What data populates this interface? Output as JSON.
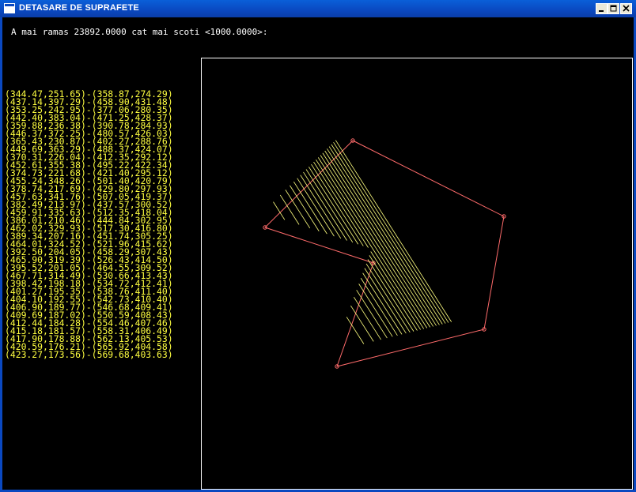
{
  "window": {
    "title": "DETASARE DE SUPRAFETE",
    "minimize_glyph": "_",
    "maximize_glyph": "□",
    "close_glyph": "×",
    "titlebar_color": "#0a48c0"
  },
  "console": {
    "prompt": "A mai ramas 23892.0000 cat mai scoti <1000.0000>:",
    "text_color": "#ffffff",
    "list_color": "#ffff40",
    "segments": [
      "(344.47,251.65)-(358.87,274.29)",
      "(437.14,397.29)-(458.90,431.48)",
      "(353.25,242.95)-(377.06,280.35)",
      "(442.40,383.04)-(471.25,428.37)",
      "(359.88,236.38)-(390.78,284.93)",
      "(446.37,372.25)-(480.57,426.03)",
      "(365.43,230.87)-(402.27,288.76)",
      "(449.69,363.29)-(488.37,424.07)",
      "(370.31,226.04)-(412.35,292.12)",
      "(452.61,355.38)-(495.22,422.34)",
      "(374.73,221.68)-(421.40,295.12)",
      "(455.24,348.26)-(501.40,420.79)",
      "(378.74,217.69)-(429.80,297.93)",
      "(457.63,341.76)-(507.05,419.37)",
      "(382.49,213.97)-(437.57,300.52)",
      "(459.91,335.63)-(512.35,418.04)",
      "(386.01,210.46)-(444.84,302.95)",
      "(462.02,329.93)-(517.30,416.80)",
      "(389.34,207.16)-(451.74,305.25)",
      "(464.01,324.52)-(521.96,415.62)",
      "(392.50,204.05)-(458.29,307.43)",
      "(465.90,319.39)-(526.43,414.50)",
      "(395.52,201.05)-(464.55,309.52)",
      "(467.71,314.49)-(530.66,413.43)",
      "(398.42,198.18)-(534.72,412.41)",
      "(401.27,195.35)-(538.76,411.40)",
      "(404.10,192.55)-(542.73,410.40)",
      "(406.90,189.77)-(546.68,409.41)",
      "(409.69,187.02)-(550.59,408.43)",
      "(412.44,184.28)-(554.46,407.46)",
      "(415.18,181.57)-(558.31,406.49)",
      "(417.90,178.88)-(562.13,405.53)",
      "(420.59,176.21)-(565.92,404.58)",
      "(423.27,173.56)-(569.68,403.63)"
    ]
  },
  "drawing": {
    "polygon_color": "#ff6b6b",
    "hatch_color": "#ffff80",
    "border_color": "#ffffff"
  }
}
